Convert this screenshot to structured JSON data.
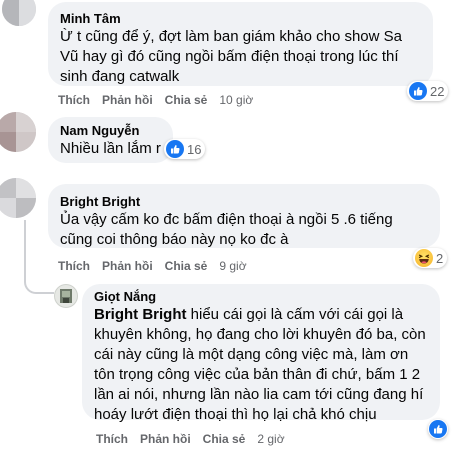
{
  "comments": [
    {
      "author": "Minh Tâm",
      "text": "Ừ t cũng để ý, đợt làm ban giám khảo cho show Sa Vũ hay gì đó cũng ngồi bấm điện thoại trong lúc thí sinh đang catwalk",
      "like_label": "Thích",
      "reply_label": "Phản hồi",
      "share_label": "Chia sẻ",
      "time": "10 giờ",
      "reaction_count": "22",
      "reaction_icon": "like-icon"
    },
    {
      "author": "Nam Nguyễn",
      "text": "Nhiều lần lắm r",
      "reaction_count": "16",
      "reaction_icon": "like-icon"
    },
    {
      "author": "Bright Bright",
      "text": "Ủa vậy cấm ko đc bấm điện thoại à ngồi 5 .6 tiếng cũng coi thông báo này nọ ko đc à",
      "like_label": "Thích",
      "reply_label": "Phản hồi",
      "share_label": "Chia sẻ",
      "time": "9 giờ",
      "reaction_count": "2",
      "reaction_icon": "haha-icon"
    }
  ],
  "reply": {
    "author": "Giọt Nắng",
    "mention": "Bright Bright",
    "text": " hiểu cái gọi là cấm với cái gọi là khuyên không, họ đang cho lời khuyên đó ba, còn cái này cũng là một dạng công việc mà, làm ơn tôn trọng công việc của bản thân đi chứ, bấm 1 2 lần ai nói, nhưng lần nào lia cam tới cũng đang hí hoáy lướt điện thoại thì họ lại chả khó chịu",
    "like_label": "Thích",
    "reply_label": "Phản hồi",
    "share_label": "Chia sẻ",
    "time": "2 giờ",
    "reaction_icon": "like-icon"
  },
  "colors": {
    "bubble": "#f0f2f5",
    "meta": "#65676b",
    "like_blue": "#1877f2"
  }
}
